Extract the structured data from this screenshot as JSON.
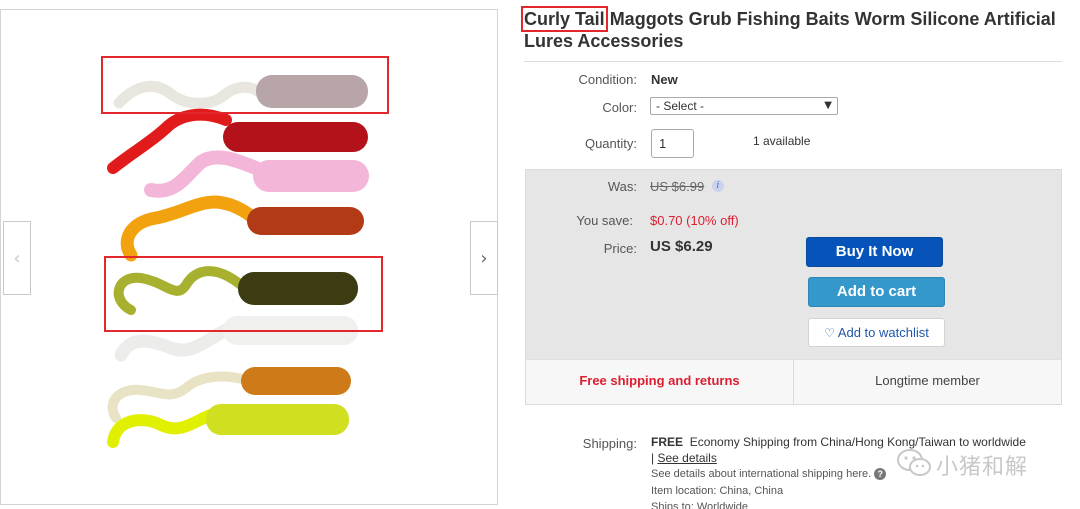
{
  "title": {
    "highlight": "Curly Tail",
    "rest": " Maggots Grub Fishing Baits Worm Silicone Artificial Lures Accessories"
  },
  "condition": {
    "label": "Condition:",
    "value": "New"
  },
  "color": {
    "label": "Color:",
    "selected": "- Select -"
  },
  "quantity": {
    "label": "Quantity:",
    "value": "1",
    "available": "1 available"
  },
  "pricing": {
    "was_label": "Was:",
    "was_value": "US $6.99",
    "save_label": "You save:",
    "save_value": "$0.70 (10% off)",
    "price_label": "Price:",
    "price_value": "US $6.29"
  },
  "actions": {
    "buy_now": "Buy It Now",
    "add_to_cart": "Add to cart",
    "add_to_watchlist": "Add to watchlist"
  },
  "promo": {
    "free_shipping": "Free shipping and returns",
    "member": "Longtime member"
  },
  "shipping": {
    "label": "Shipping:",
    "free": "FREE",
    "method": "Economy Shipping from China/Hong Kong/Taiwan to worldwide",
    "see_details": "See details",
    "intl_note": "See details about international shipping here.",
    "location_label": "Item location:",
    "location_value": "China, China",
    "ships_to_label": "Ships to:",
    "ships_to_value": "Worldwide"
  },
  "watermark": {
    "text": "小猪和解"
  },
  "icons": {
    "prev": "chevron-left-icon",
    "next": "chevron-right-icon",
    "dropdown": "caret-down-icon",
    "info": "info-icon",
    "heart": "heart-icon",
    "help": "question-icon",
    "wechat": "wechat-icon"
  },
  "colors": {
    "highlight_box": "#e2272d",
    "buy_now": "#0654ba",
    "add_to_cart": "#3498ca",
    "sale_red": "#dd1e31",
    "buybox_bg": "#e6e6e6"
  },
  "lure_colors": [
    {
      "body": "#b8a5a8",
      "tail": "#e8e6df"
    },
    {
      "body": "#b3121a",
      "tail": "#e11b1b"
    },
    {
      "body": "#f3b5d8",
      "tail": "#f3b5d8"
    },
    {
      "body": "#b23a17",
      "tail": "#f2a20f"
    },
    {
      "body": "#3c3b12",
      "tail": "#a8b030"
    },
    {
      "body": "#f0f0ee",
      "tail": "#f4f4f2"
    },
    {
      "body": "#cf7a18",
      "tail": "#e9e3c6"
    },
    {
      "body": "#d0e020",
      "tail": "#e1f000"
    }
  ]
}
